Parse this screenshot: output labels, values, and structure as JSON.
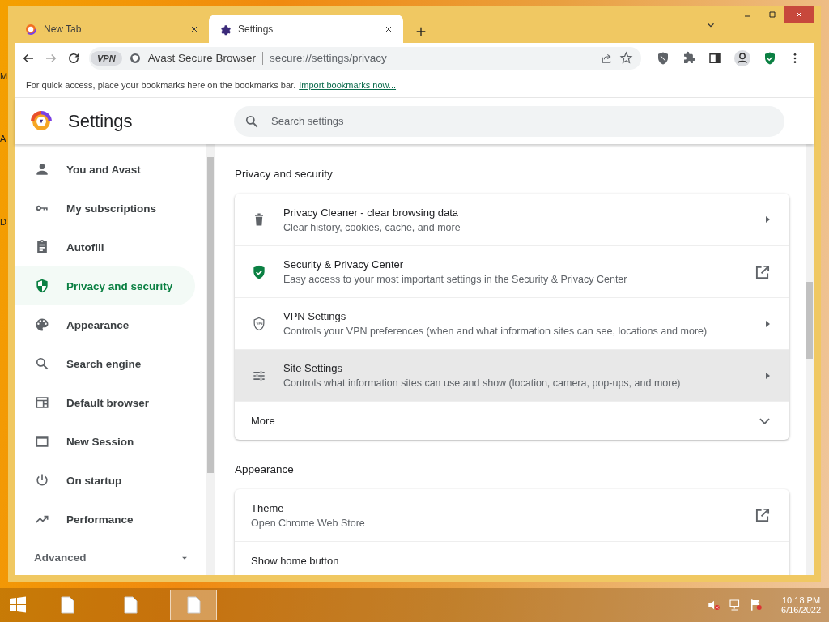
{
  "desktop": {
    "edge_labels": [
      "M",
      "A",
      "D"
    ]
  },
  "tabs": [
    {
      "title": "New Tab",
      "selected": false
    },
    {
      "title": "Settings",
      "selected": true
    }
  ],
  "address_bar": {
    "vpn_badge": "VPN",
    "site_name": "Avast Secure Browser",
    "url": "secure://settings/privacy"
  },
  "bookmarks_bar": {
    "message": "For quick access, place your bookmarks here on the bookmarks bar.",
    "link": "Import bookmarks now..."
  },
  "settings": {
    "title": "Settings",
    "search": {
      "placeholder": "Search settings"
    }
  },
  "sidebar": {
    "items": [
      {
        "label": "You and Avast",
        "selected": false
      },
      {
        "label": "My subscriptions",
        "selected": false
      },
      {
        "label": "Autofill",
        "selected": false
      },
      {
        "label": "Privacy and security",
        "selected": true
      },
      {
        "label": "Appearance",
        "selected": false
      },
      {
        "label": "Search engine",
        "selected": false
      },
      {
        "label": "Default browser",
        "selected": false
      },
      {
        "label": "New Session",
        "selected": false
      },
      {
        "label": "On startup",
        "selected": false
      },
      {
        "label": "Performance",
        "selected": false
      }
    ],
    "advanced": "Advanced"
  },
  "sections": [
    {
      "title": "Privacy and security",
      "rows": [
        {
          "kind": "link",
          "title": "Privacy Cleaner - clear browsing data",
          "subtitle": "Clear history, cookies, cache, and more",
          "highlighted": false
        },
        {
          "kind": "external",
          "title": "Security & Privacy Center",
          "subtitle": "Easy access to your most important settings in the Security & Privacy Center",
          "highlighted": false
        },
        {
          "kind": "link",
          "title": "VPN Settings",
          "subtitle": "Controls your VPN preferences (when and what information sites can see, locations and more)",
          "highlighted": false
        },
        {
          "kind": "link",
          "title": "Site Settings",
          "subtitle": "Controls what information sites can use and show (location, camera, pop-ups, and more)",
          "highlighted": true
        },
        {
          "kind": "expand",
          "title": "More",
          "highlighted": false
        }
      ]
    },
    {
      "title": "Appearance",
      "rows": [
        {
          "kind": "external",
          "title": "Theme",
          "subtitle": "Open Chrome Web Store",
          "highlighted": false
        },
        {
          "kind": "plain",
          "title": "Show home button",
          "highlighted": false
        }
      ]
    }
  ],
  "taskbar": {
    "apps": [
      {
        "active": false
      },
      {
        "active": false
      },
      {
        "active": true
      }
    ],
    "time": "10:18 PM",
    "date": "6/16/2022"
  }
}
